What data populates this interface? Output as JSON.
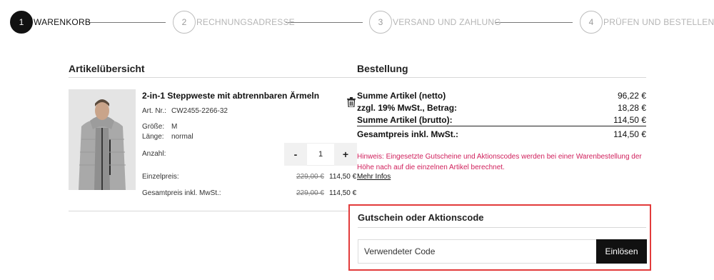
{
  "stepper": {
    "steps": [
      {
        "number": "1",
        "label": "WARENKORB"
      },
      {
        "number": "2",
        "label": "RECHNUNGSADRESSE"
      },
      {
        "number": "3",
        "label": "VERSAND UND ZAHLUNG"
      },
      {
        "number": "4",
        "label": "PRÜFEN UND BESTELLEN"
      }
    ]
  },
  "overview": {
    "title": "Artikelübersicht",
    "product": {
      "name": "2-in-1 Steppweste mit abtrennbaren Ärmeln",
      "art_label": "Art. Nr.:",
      "art_value": "CW2455-2266-32",
      "size_label": "Größe:",
      "size_value": "M",
      "length_label": "Länge:",
      "length_value": "normal",
      "qty_label": "Anzahl:",
      "qty_minus": "-",
      "qty_value": "1",
      "qty_plus": "+",
      "unit_price_label": "Einzelpreis:",
      "unit_price_old": "229,00 €",
      "unit_price_new": "114,50 €",
      "total_label": "Gesamtpreis inkl. MwSt.:",
      "total_old": "229,00 €",
      "total_new": "114,50 €"
    }
  },
  "order": {
    "title": "Bestellung",
    "net_label": "Summe Artikel (netto)",
    "net_value": "96,22 €",
    "vat_label": "zzgl. 19% MwSt., Betrag:",
    "vat_value": "18,28 €",
    "gross_label": "Summe Artikel (brutto):",
    "gross_value": "114,50 €",
    "total_label": "Gesamtpreis inkl. MwSt.:",
    "total_value": "114,50 €",
    "hint": "Hinweis: Eingesetzte Gutscheine und Aktionscodes werden bei einer Warenbestellung der Höhe nach auf die einzelnen Artikel berechnet.",
    "more_link": "Mehr Infos"
  },
  "coupon": {
    "title": "Gutschein oder Aktionscode",
    "placeholder": "Verwendeter Code",
    "button": "Einlösen"
  },
  "colors": {
    "accent_black": "#111111",
    "hint_red": "#d0205c",
    "highlight_border": "#e23b3b"
  },
  "icons": [
    "trash-icon",
    "product-image"
  ]
}
